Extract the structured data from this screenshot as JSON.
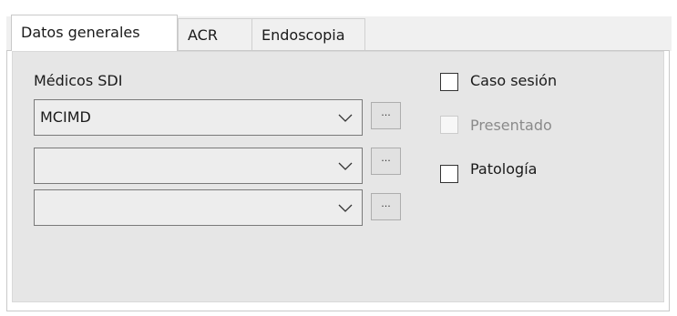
{
  "tabs": [
    {
      "label": "Datos generales",
      "active": true
    },
    {
      "label": "ACR",
      "active": false
    },
    {
      "label": "Endoscopia",
      "active": false
    }
  ],
  "medicos": {
    "label": "Médicos SDI",
    "combos": [
      {
        "value": "MCIMD"
      },
      {
        "value": ""
      },
      {
        "value": ""
      }
    ],
    "browse_button_label": "..."
  },
  "checkboxes": [
    {
      "label": "Caso sesión",
      "checked": false,
      "enabled": true
    },
    {
      "label": "Presentado",
      "checked": false,
      "enabled": false
    },
    {
      "label": "Patología",
      "checked": false,
      "enabled": true
    }
  ],
  "colors": {
    "panel_bg": "#e6e6e6",
    "active_tab_bg": "#ffffff",
    "disabled_text": "#8a8a8a"
  }
}
